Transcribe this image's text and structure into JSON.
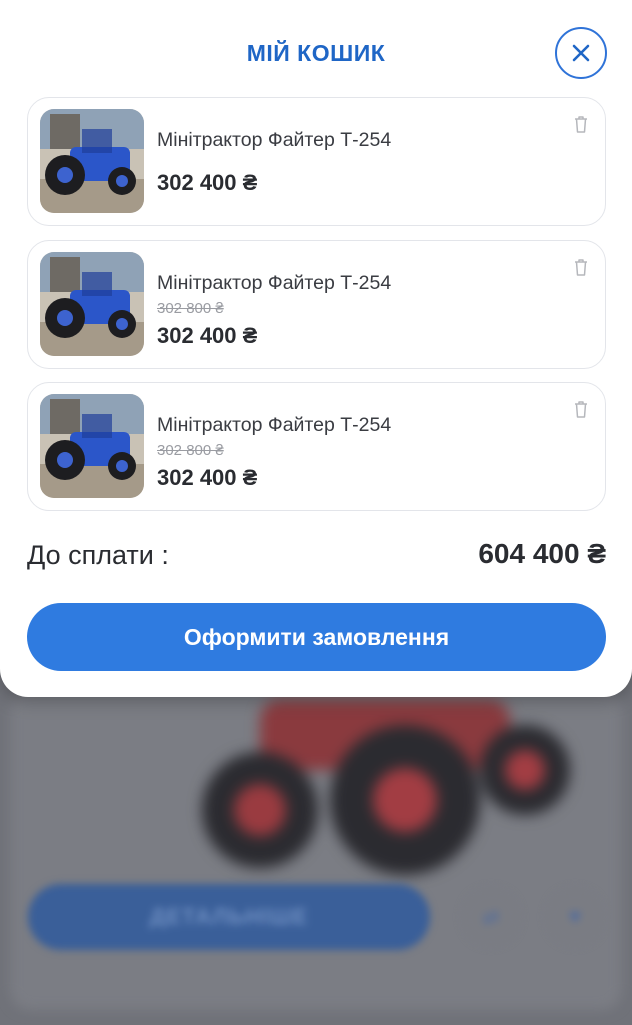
{
  "cart": {
    "title": "МІЙ КОШИК",
    "items": [
      {
        "name": "Мінітрактор Файтер Т-254",
        "old_price": "",
        "price": "302 400 ₴"
      },
      {
        "name": "Мінітрактор Файтер Т-254",
        "old_price": "302 800 ₴",
        "price": "302 400 ₴"
      },
      {
        "name": "Мінітрактор Файтер Т-254",
        "old_price": "302 800 ₴",
        "price": "302 400 ₴"
      }
    ],
    "total_label": "До сплати :",
    "total_value": "604 400 ₴",
    "checkout_label": "Оформити замовлення"
  },
  "background": {
    "details_label": "ДЕТАЛЬНІШЕ"
  },
  "icons": {
    "close": "close-icon",
    "trash": "trash-icon"
  },
  "colors": {
    "accent": "#2f7be0",
    "title": "#1f66c6",
    "overlay": "#707279",
    "tractor_blue": "#2b56c9"
  }
}
